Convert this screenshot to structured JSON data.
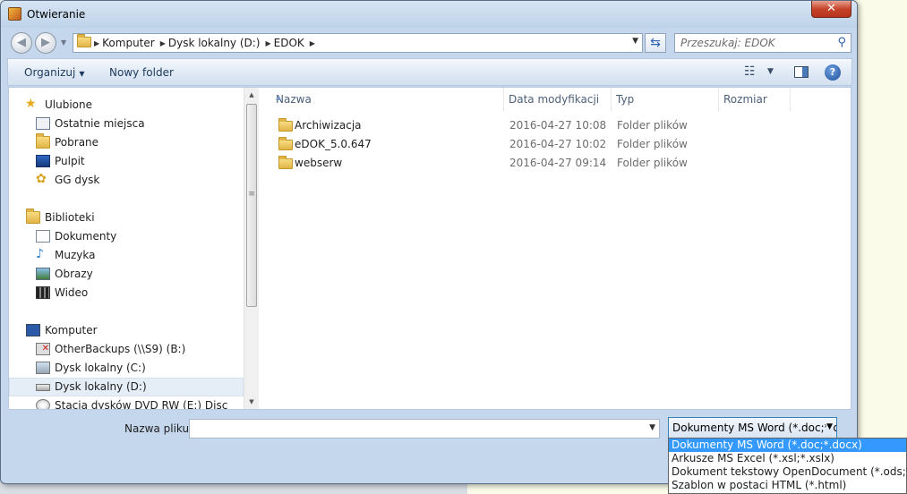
{
  "window": {
    "title": "Otwieranie",
    "close_label": "✕"
  },
  "address": {
    "crumbs": [
      "Komputer",
      "Dysk lokalny (D:)",
      "EDOK"
    ]
  },
  "search": {
    "placeholder": "Przeszukaj: EDOK"
  },
  "toolbar": {
    "organize_label": "Organizuj",
    "new_folder_label": "Nowy folder"
  },
  "sidebar": {
    "favorites": {
      "label": "Ulubione",
      "items": [
        "Ostatnie miejsca",
        "Pobrane",
        "Pulpit",
        "GG dysk"
      ]
    },
    "libraries": {
      "label": "Biblioteki",
      "items": [
        "Dokumenty",
        "Muzyka",
        "Obrazy",
        "Wideo"
      ]
    },
    "computer": {
      "label": "Komputer",
      "items": [
        "OtherBackups (\\\\S9) (B:)",
        "Dysk lokalny (C:)",
        "Dysk lokalny (D:)",
        "Stacja dysków DVD RW (E:) Disc"
      ]
    }
  },
  "columns": {
    "name": "Nazwa",
    "modified": "Data modyfikacji",
    "type": "Typ",
    "size": "Rozmiar"
  },
  "files": [
    {
      "name": "Archiwizacja",
      "modified": "2016-04-27 10:08",
      "type": "Folder plików"
    },
    {
      "name": "eDOK_5.0.647",
      "modified": "2016-04-27 10:02",
      "type": "Folder plików"
    },
    {
      "name": "webserw",
      "modified": "2016-04-27 09:14",
      "type": "Folder plików"
    }
  ],
  "filename": {
    "label": "Nazwa pliku:",
    "value": ""
  },
  "filetype": {
    "selected": "Dokumenty MS Word (*.doc;*.docx)",
    "options": [
      "Dokumenty MS Word (*.doc;*.docx)",
      "Arkusze MS Excel (*.xsl;*.xslx)",
      "Dokument tekstowy OpenDocument (*.ods;*.odt)",
      "Szablon w postaci HTML (*.html)"
    ]
  }
}
